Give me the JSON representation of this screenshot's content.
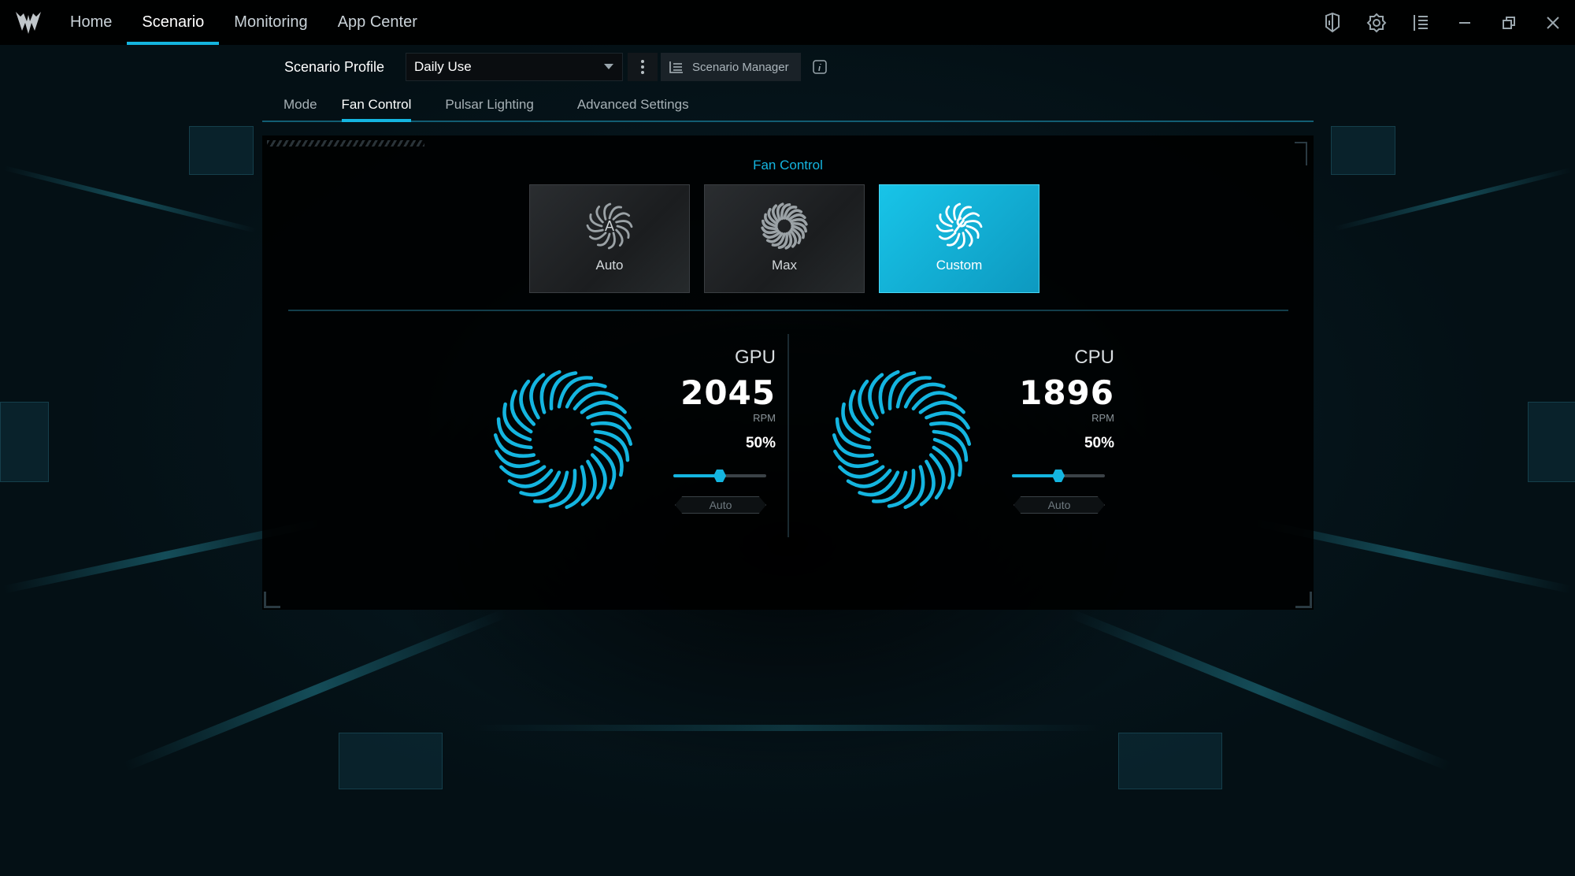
{
  "titlebar": {
    "nav": [
      "Home",
      "Scenario",
      "Monitoring",
      "App Center"
    ],
    "active_nav": "Scenario",
    "icons": [
      "keyboard-icon",
      "settings-icon",
      "menu-icon",
      "minimize-icon",
      "restore-icon",
      "close-icon"
    ]
  },
  "profile": {
    "label": "Scenario Profile",
    "selected": "Daily Use",
    "manager_label": "Scenario Manager"
  },
  "subtabs": [
    "Mode",
    "Fan Control",
    "Pulsar Lighting",
    "Advanced Settings"
  ],
  "active_subtab": "Fan Control",
  "fan_control": {
    "title": "Fan Control",
    "modes": [
      "Auto",
      "Max",
      "Custom"
    ],
    "active_mode": "Custom",
    "fans": [
      {
        "name": "GPU",
        "rpm": "2045",
        "unit": "RPM",
        "percent_label": "50%",
        "level": 0.5,
        "auto_label": "Auto"
      },
      {
        "name": "CPU",
        "rpm": "1896",
        "unit": "RPM",
        "percent_label": "50%",
        "level": 0.5,
        "auto_label": "Auto"
      }
    ]
  },
  "colors": {
    "accent": "#14b5e0",
    "background": "#041015"
  }
}
